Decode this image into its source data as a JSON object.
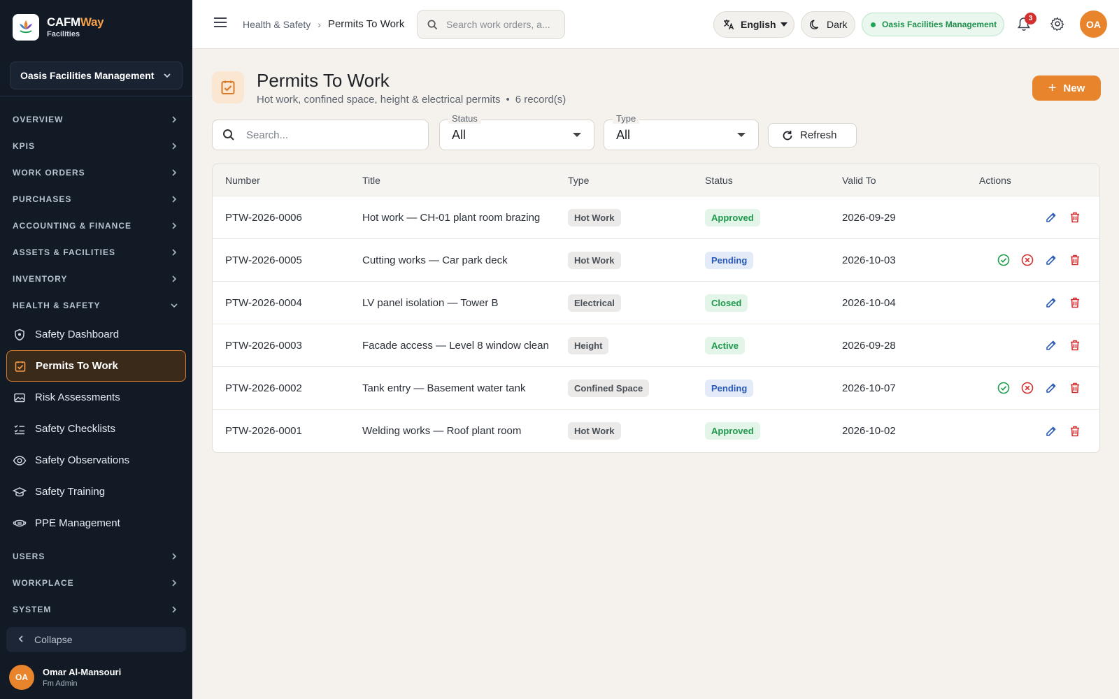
{
  "brand": {
    "name_main": "CAFM",
    "name_accent": "Way",
    "subtitle": "Facilities"
  },
  "sidebar": {
    "org_selector": "Oasis Facilities Management",
    "sections_top": [
      {
        "label": "OVERVIEW"
      },
      {
        "label": "KPIS"
      },
      {
        "label": "WORK ORDERS"
      },
      {
        "label": "PURCHASES"
      },
      {
        "label": "ACCOUNTING & FINANCE"
      },
      {
        "label": "ASSETS & FACILITIES"
      },
      {
        "label": "INVENTORY"
      }
    ],
    "open_section": {
      "label": "HEALTH & SAFETY"
    },
    "sub_items": [
      {
        "label": "Safety Dashboard",
        "icon": "shield-icon"
      },
      {
        "label": "Permits To Work",
        "icon": "checkbox-icon",
        "active": true
      },
      {
        "label": "Risk Assessments",
        "icon": "image-card-icon"
      },
      {
        "label": "Safety Checklists",
        "icon": "checklist-icon"
      },
      {
        "label": "Safety Observations",
        "icon": "eye-icon"
      },
      {
        "label": "Safety Training",
        "icon": "graduation-cap-icon"
      },
      {
        "label": "PPE Management",
        "icon": "mask-icon"
      }
    ],
    "sections_bottom": [
      {
        "label": "USERS"
      },
      {
        "label": "WORKPLACE"
      },
      {
        "label": "SYSTEM"
      }
    ],
    "collapse_label": "Collapse",
    "user": {
      "initials": "OA",
      "name": "Omar Al-Mansouri",
      "role": "Fm Admin"
    }
  },
  "topbar": {
    "breadcrumb": {
      "parent": "Health & Safety",
      "current": "Permits To Work"
    },
    "search_placeholder": "Search work orders, a...",
    "language": "English",
    "theme_toggle": "Dark",
    "org_chip": "Oasis Facilities Management",
    "notification_count": "3",
    "avatar_initials": "OA"
  },
  "page": {
    "title": "Permits To Work",
    "subtitle": "Hot work, confined space, height & electrical permits",
    "record_count": "6 record(s)",
    "new_button": "New"
  },
  "filters": {
    "search_placeholder": "Search...",
    "status": {
      "label": "Status",
      "value": "All"
    },
    "type": {
      "label": "Type",
      "value": "All"
    },
    "refresh_label": "Refresh"
  },
  "table": {
    "headers": [
      "Number",
      "Title",
      "Type",
      "Status",
      "Valid To",
      "Actions"
    ],
    "rows": [
      {
        "number": "PTW-2026-0006",
        "title": "Hot work — CH-01 plant room brazing",
        "type": "Hot Work",
        "status": "Approved",
        "valid_to": "2026-09-29",
        "approve_actions": false
      },
      {
        "number": "PTW-2026-0005",
        "title": "Cutting works — Car park deck",
        "type": "Hot Work",
        "status": "Pending",
        "valid_to": "2026-10-03",
        "approve_actions": true
      },
      {
        "number": "PTW-2026-0004",
        "title": "LV panel isolation — Tower B",
        "type": "Electrical",
        "status": "Closed",
        "valid_to": "2026-10-04",
        "approve_actions": false
      },
      {
        "number": "PTW-2026-0003",
        "title": "Facade access — Level 8 window clean",
        "type": "Height",
        "status": "Active",
        "valid_to": "2026-09-28",
        "approve_actions": false
      },
      {
        "number": "PTW-2026-0002",
        "title": "Tank entry — Basement water tank",
        "type": "Confined Space",
        "status": "Pending",
        "valid_to": "2026-10-07",
        "approve_actions": true
      },
      {
        "number": "PTW-2026-0001",
        "title": "Welding works — Roof plant room",
        "type": "Hot Work",
        "status": "Approved",
        "valid_to": "2026-10-02",
        "approve_actions": false
      }
    ]
  },
  "colors": {
    "accent": "#e8842c",
    "sidebar_bg": "#121a26",
    "status": {
      "Approved": {
        "bg": "#e3f4e8",
        "fg": "#1e9a4b"
      },
      "Pending": {
        "bg": "#e3ebf8",
        "fg": "#2a5ab8"
      },
      "Closed": {
        "bg": "#e3f4e8",
        "fg": "#1e9a4b"
      },
      "Active": {
        "bg": "#e3f4e8",
        "fg": "#1e9a4b"
      }
    }
  }
}
